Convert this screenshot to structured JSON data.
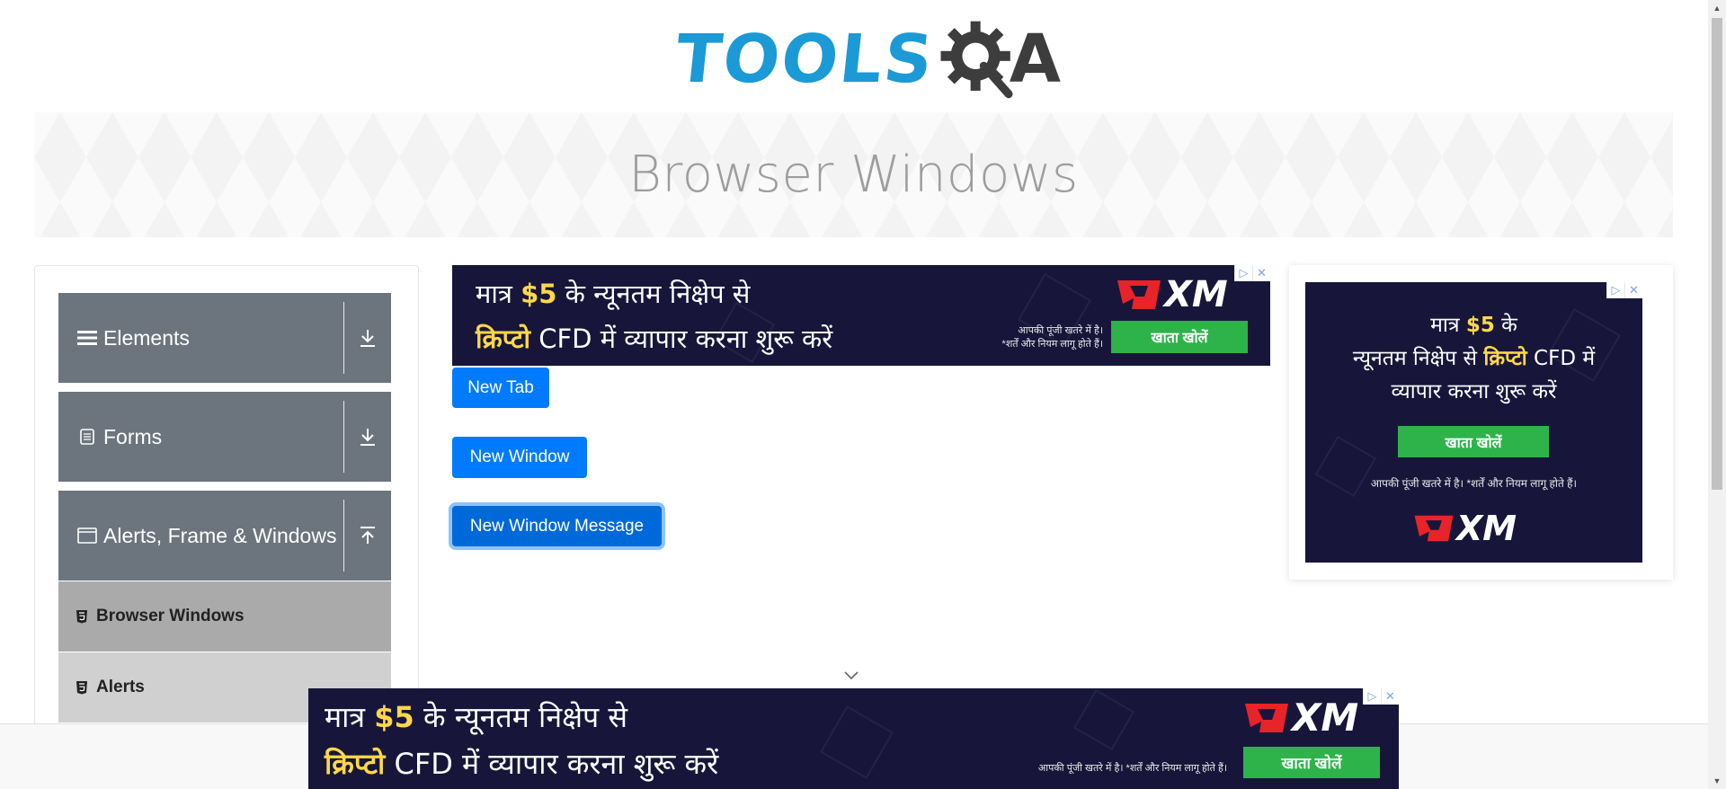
{
  "header": {
    "logo_text_left": "TOOLS",
    "logo_text_right": "A",
    "logo_brand": "TOOLSQA",
    "banner_title": "Browser Windows"
  },
  "sidebar": {
    "groups": [
      {
        "label": "Elements",
        "icon": "hamburger-icon",
        "state": "collapsed"
      },
      {
        "label": "Forms",
        "icon": "document-icon",
        "state": "collapsed"
      },
      {
        "label": "Alerts, Frame & Windows",
        "icon": "window-icon",
        "state": "expanded"
      }
    ],
    "items": [
      {
        "label": "Browser Windows",
        "active": true
      },
      {
        "label": "Alerts",
        "active": false
      }
    ]
  },
  "main": {
    "buttons": {
      "new_tab": "New Tab",
      "new_window": "New Window",
      "new_window_message": "New Window Message"
    }
  },
  "ads": {
    "top": {
      "line1_pre": "मात्र ",
      "line1_amount": "$5",
      "line1_post": " के न्यूनतम निक्षेप से",
      "line2_highlight": "क्रिप्टो",
      "line2_post": " CFD में  व्यापार करना शुरू करें",
      "disclaimer_line1": "आपकी पूंजी खतरे में है।",
      "disclaimer_line2": "*शर्तें और नियम लागू होते हैं।",
      "cta": "खाता खोलें",
      "brand": "XM"
    },
    "side": {
      "line1_pre": "मात्र ",
      "line1_amount": "$5",
      "line1_post": " के",
      "line2_pre": "न्यूनतम निक्षेप से ",
      "line2_highlight": "क्रिप्टो",
      "line2_post": " CFD में",
      "line3": "व्यापार करना शुरू करें",
      "cta": "खाता खोलें",
      "disclaimer": "आपकी पूंजी खतरे में है। *शर्तें और नियम लागू होते हैं।",
      "brand": "XM"
    },
    "bottom": {
      "line1_pre": "मात्र ",
      "line1_amount": "$5",
      "line1_post": " के न्यूनतम निक्षेप से",
      "line2_highlight": "क्रिप्टो",
      "line2_post": " CFD में  व्यापार करना शुरू करें",
      "disclaimer": "आपकी पूंजी खतरे में है। *शर्तें और नियम लागू होते हैं।",
      "cta": "खाता खोलें",
      "brand": "XM"
    },
    "close_glyph": "✕",
    "adchoices_glyph": "▷"
  },
  "colors": {
    "primary": "#007bff",
    "sidebar_group": "#6c757d",
    "sidebar_active": "#aaaaaa",
    "sidebar_item": "#d0d0d0",
    "ad_bg": "#17163a",
    "ad_cta": "#2db34a",
    "logo_blue": "#1b9ad6",
    "xm_red": "#e8232a"
  }
}
